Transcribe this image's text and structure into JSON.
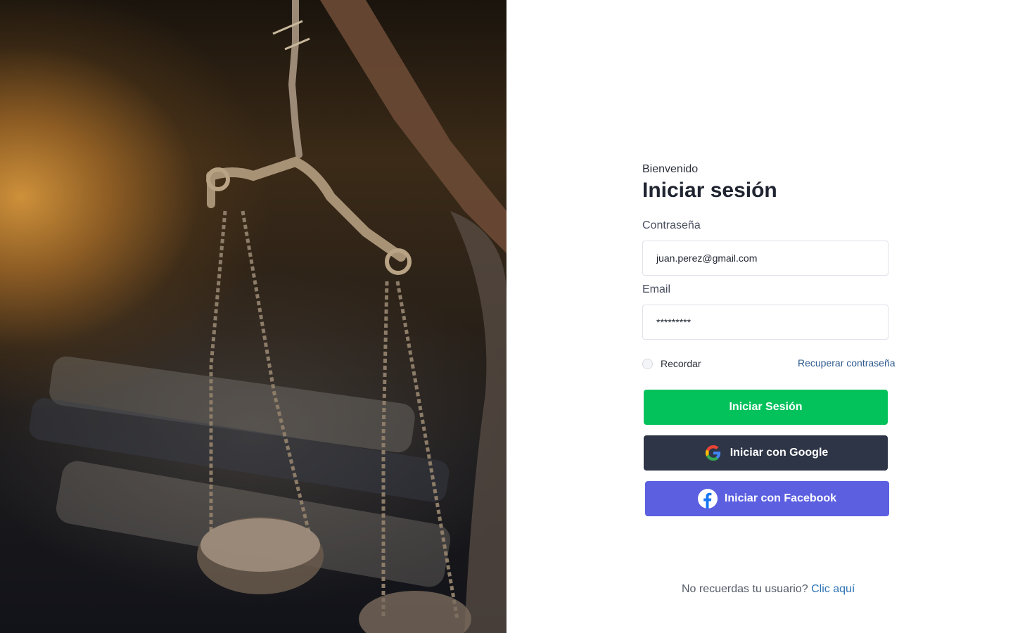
{
  "login": {
    "greeting": "Bienvenido",
    "title": "Iniciar sesión",
    "field1_label": "Contraseña",
    "field1_value": "juan.perez@gmail.com",
    "field2_label": "Email",
    "field2_value": "*********",
    "remember_label": "Recordar",
    "remember_checked": false,
    "recover_link": "Recuperar contraseña",
    "submit_label": "Iniciar Sesión",
    "google_label": "Iniciar con Google",
    "facebook_label": "Iniciar con Facebook"
  },
  "footer": {
    "prompt": "No recuerdas tu usuario? ",
    "link": "Clic aquí"
  },
  "icons": {
    "google": "google-icon",
    "facebook": "facebook-icon"
  },
  "colors": {
    "primary": "#03c25c",
    "google_button": "#2d3546",
    "facebook_button": "#5b5fe0",
    "link": "#2f74b5"
  }
}
